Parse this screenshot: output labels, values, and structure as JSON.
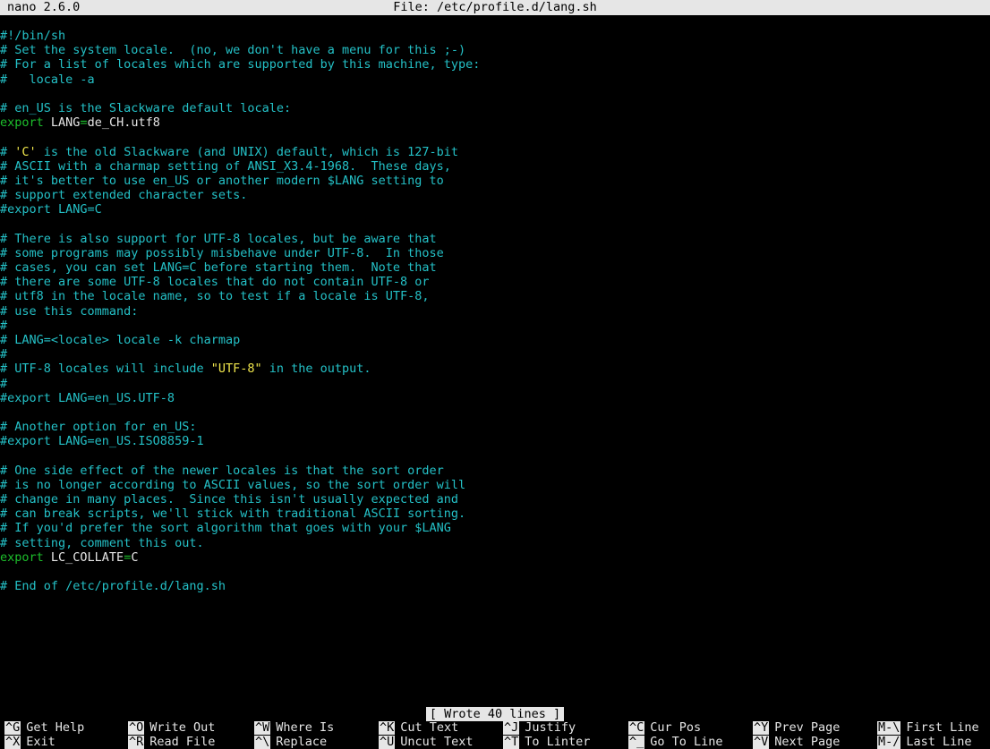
{
  "titlebar": {
    "version": "nano 2.6.0",
    "file": "File: /etc/profile.d/lang.sh"
  },
  "editor": {
    "lines": [
      [
        {
          "t": "#!/bin/sh",
          "c": "comment"
        }
      ],
      [
        {
          "t": "# Set the system locale.  (no, we don't have a menu for this ;-)",
          "c": "comment"
        }
      ],
      [
        {
          "t": "# For a list of locales which are supported by this machine, type:",
          "c": "comment"
        }
      ],
      [
        {
          "t": "#   locale -a",
          "c": "comment"
        }
      ],
      [
        {
          "t": "",
          "c": "text"
        }
      ],
      [
        {
          "t": "# en_US is the Slackware default locale:",
          "c": "comment"
        }
      ],
      [
        {
          "t": "export",
          "c": "kw"
        },
        {
          "t": " LANG",
          "c": "text"
        },
        {
          "t": "=",
          "c": "kw"
        },
        {
          "t": "de_CH.utf8",
          "c": "text"
        }
      ],
      [
        {
          "t": "",
          "c": "text"
        }
      ],
      [
        {
          "t": "# ",
          "c": "comment"
        },
        {
          "t": "'C'",
          "c": "str"
        },
        {
          "t": " is the old Slackware (and UNIX) default, which is 127-bit",
          "c": "comment"
        }
      ],
      [
        {
          "t": "# ASCII with a charmap setting of ANSI_X3.4-1968.  These days,",
          "c": "comment"
        }
      ],
      [
        {
          "t": "# it's better to use en_US or another modern $LANG setting to",
          "c": "comment"
        }
      ],
      [
        {
          "t": "# support extended character sets.",
          "c": "comment"
        }
      ],
      [
        {
          "t": "#export LANG=C",
          "c": "comment"
        }
      ],
      [
        {
          "t": "",
          "c": "text"
        }
      ],
      [
        {
          "t": "# There is also support for UTF-8 locales, but be aware that",
          "c": "comment"
        }
      ],
      [
        {
          "t": "# some programs may possibly misbehave under UTF-8.  In those",
          "c": "comment"
        }
      ],
      [
        {
          "t": "# cases, you can set LANG=C before starting them.  Note that",
          "c": "comment"
        }
      ],
      [
        {
          "t": "# there are some UTF-8 locales that do not contain UTF-8 or",
          "c": "comment"
        }
      ],
      [
        {
          "t": "# utf8 in the locale name, so to test if a locale is UTF-8,",
          "c": "comment"
        }
      ],
      [
        {
          "t": "# use this command:",
          "c": "comment"
        }
      ],
      [
        {
          "t": "#",
          "c": "comment"
        }
      ],
      [
        {
          "t": "# LANG=<locale> locale -k charmap",
          "c": "comment"
        }
      ],
      [
        {
          "t": "#",
          "c": "comment"
        }
      ],
      [
        {
          "t": "# UTF-8 locales will include ",
          "c": "comment"
        },
        {
          "t": "\"UTF-8\"",
          "c": "str"
        },
        {
          "t": " in the output.",
          "c": "comment"
        }
      ],
      [
        {
          "t": "#",
          "c": "comment"
        }
      ],
      [
        {
          "t": "#export LANG=en_US.UTF-8",
          "c": "comment"
        }
      ],
      [
        {
          "t": "",
          "c": "text"
        }
      ],
      [
        {
          "t": "# Another option for en_US:",
          "c": "comment"
        }
      ],
      [
        {
          "t": "#export LANG=en_US.ISO8859-1",
          "c": "comment"
        }
      ],
      [
        {
          "t": "",
          "c": "text"
        }
      ],
      [
        {
          "t": "# One side effect of the newer locales is that the sort order",
          "c": "comment"
        }
      ],
      [
        {
          "t": "# is no longer according to ASCII values, so the sort order will",
          "c": "comment"
        }
      ],
      [
        {
          "t": "# change in many places.  Since this isn't usually expected and",
          "c": "comment"
        }
      ],
      [
        {
          "t": "# can break scripts, we'll stick with traditional ASCII sorting.",
          "c": "comment"
        }
      ],
      [
        {
          "t": "# If you'd prefer the sort algorithm that goes with your $LANG",
          "c": "comment"
        }
      ],
      [
        {
          "t": "# setting, comment this out.",
          "c": "comment"
        }
      ],
      [
        {
          "t": "export",
          "c": "kw"
        },
        {
          "t": " LC_COLLATE",
          "c": "text"
        },
        {
          "t": "=",
          "c": "kw"
        },
        {
          "t": "C",
          "c": "text"
        }
      ],
      [
        {
          "t": "",
          "c": "text"
        }
      ],
      [
        {
          "t": "# End of /etc/profile.d/lang.sh",
          "c": "comment"
        }
      ]
    ]
  },
  "status_message": "[ Wrote 40 lines ]",
  "shortcuts": {
    "top": [
      {
        "key": "^G",
        "label": "Get Help",
        "name": "get-help"
      },
      {
        "key": "^O",
        "label": "Write Out",
        "name": "write-out"
      },
      {
        "key": "^W",
        "label": "Where Is",
        "name": "where-is"
      },
      {
        "key": "^K",
        "label": "Cut Text",
        "name": "cut-text"
      },
      {
        "key": "^J",
        "label": "Justify",
        "name": "justify"
      },
      {
        "key": "^C",
        "label": "Cur Pos",
        "name": "cur-pos"
      },
      {
        "key": "^Y",
        "label": "Prev Page",
        "name": "prev-page"
      },
      {
        "key": "M-\\",
        "label": "First Line",
        "name": "first-line"
      }
    ],
    "bottom": [
      {
        "key": "^X",
        "label": "Exit",
        "name": "exit"
      },
      {
        "key": "^R",
        "label": "Read File",
        "name": "read-file"
      },
      {
        "key": "^\\",
        "label": "Replace",
        "name": "replace"
      },
      {
        "key": "^U",
        "label": "Uncut Text",
        "name": "uncut-text"
      },
      {
        "key": "^T",
        "label": "To Linter",
        "name": "to-linter"
      },
      {
        "key": "^_",
        "label": "Go To Line",
        "name": "go-to-line"
      },
      {
        "key": "^V",
        "label": "Next Page",
        "name": "next-page"
      },
      {
        "key": "M-/",
        "label": "Last Line",
        "name": "last-line"
      }
    ]
  },
  "colors": {
    "background": "#000000",
    "comment": "#24c1c7",
    "keyword": "#1dbf2c",
    "text": "#e6e6e6",
    "string": "#f0e64c",
    "bar": "#e6e6e6"
  }
}
